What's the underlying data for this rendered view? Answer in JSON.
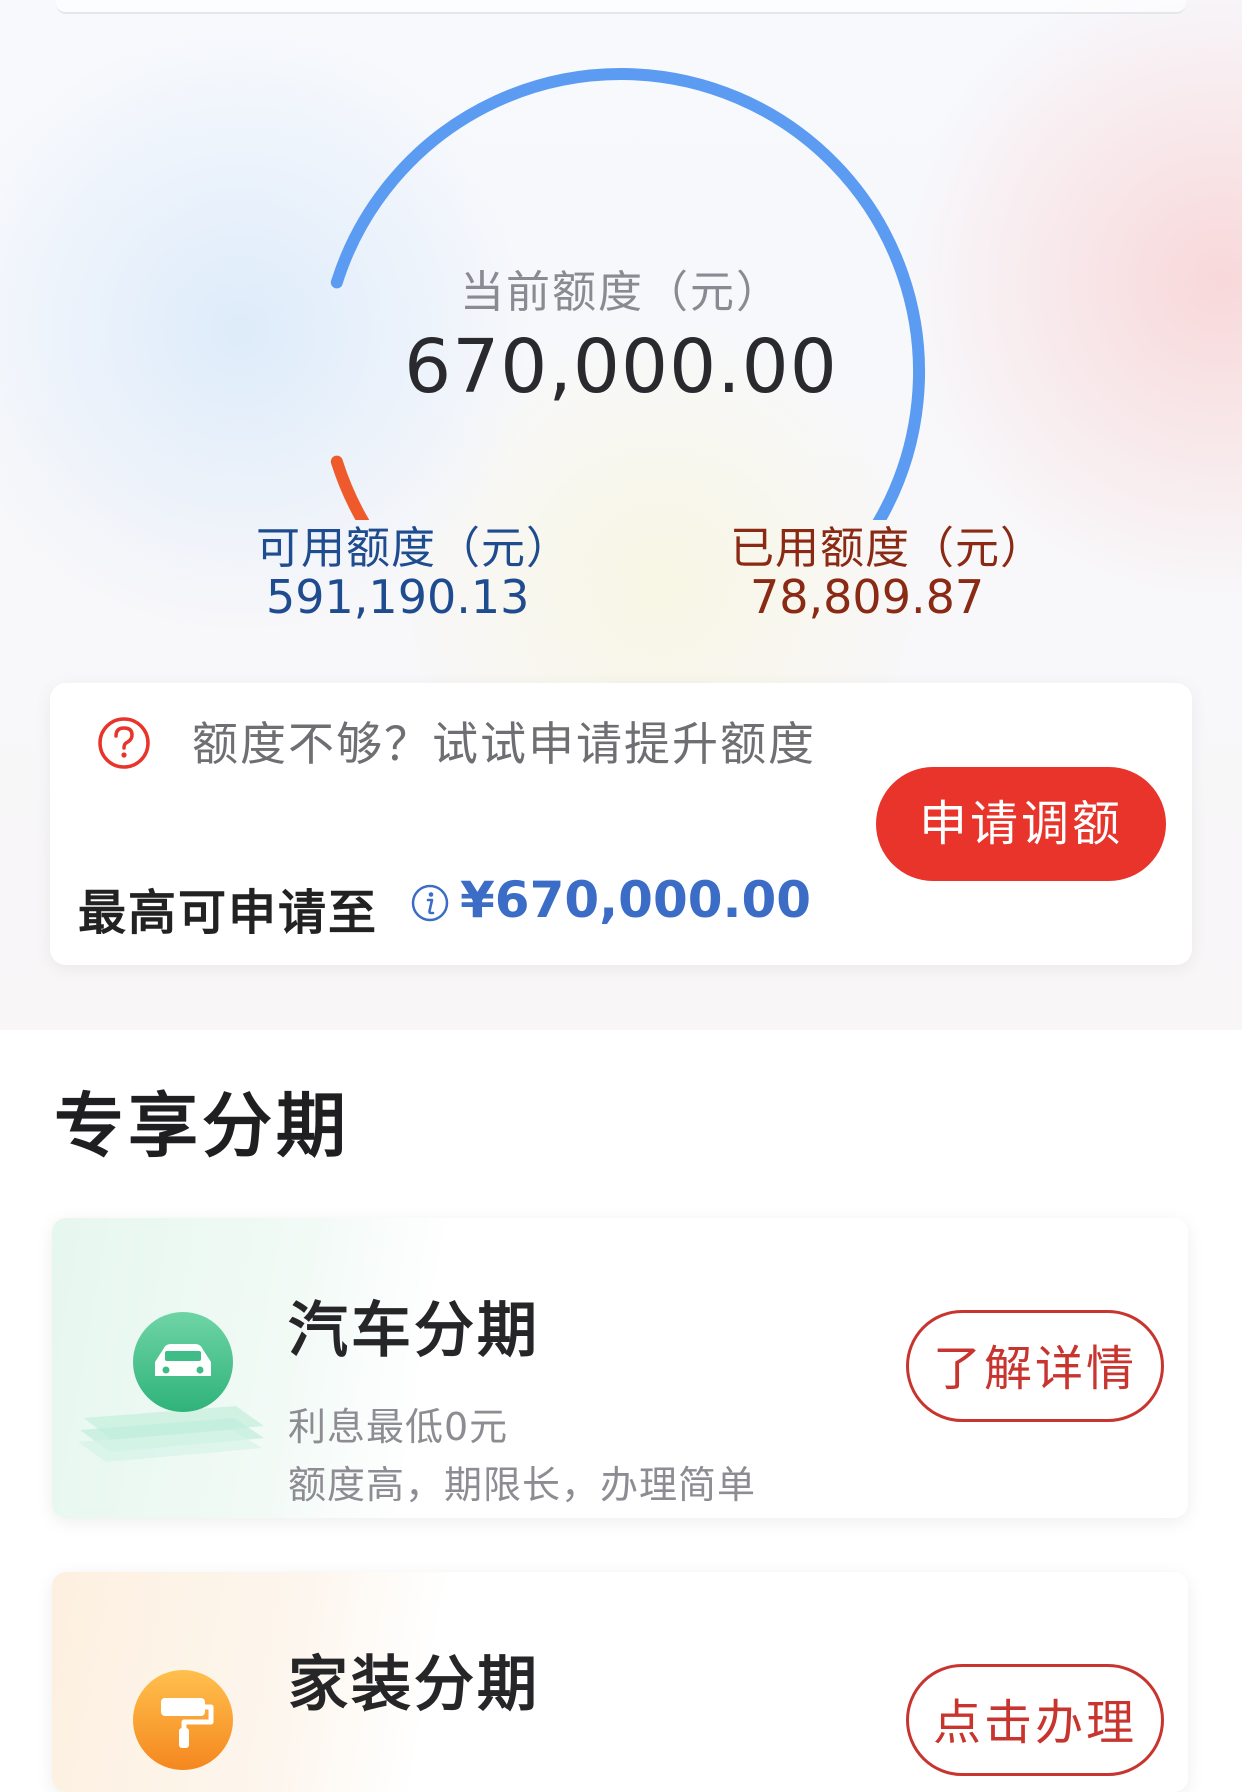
{
  "credit": {
    "current_label": "当前额度（元）",
    "current_value": "670,000.00",
    "available_label": "可用额度（元）",
    "available_value": "591,190.13",
    "used_label": "已用额度（元）",
    "used_value": "78,809.87",
    "used_fraction": 0.118
  },
  "limit_card": {
    "prompt": "额度不够？试试申请提升额度",
    "max_label": "最高可申请至",
    "max_value": "¥670,000.00",
    "apply_button": "申请调额"
  },
  "section": {
    "title": "专享分期"
  },
  "products": [
    {
      "title": "汽车分期",
      "line1": "利息最低0元",
      "line2": "额度高，期限长，办理简单",
      "button": "了解详情",
      "icon": "car-icon"
    },
    {
      "title": "家装分期",
      "button": "点击办理",
      "icon": "paint-roller-icon"
    }
  ],
  "colors": {
    "available": "#5b9bf1",
    "used": "#ef5a2d",
    "accent_red": "#e8342a",
    "link_blue": "#3b6cc6"
  }
}
